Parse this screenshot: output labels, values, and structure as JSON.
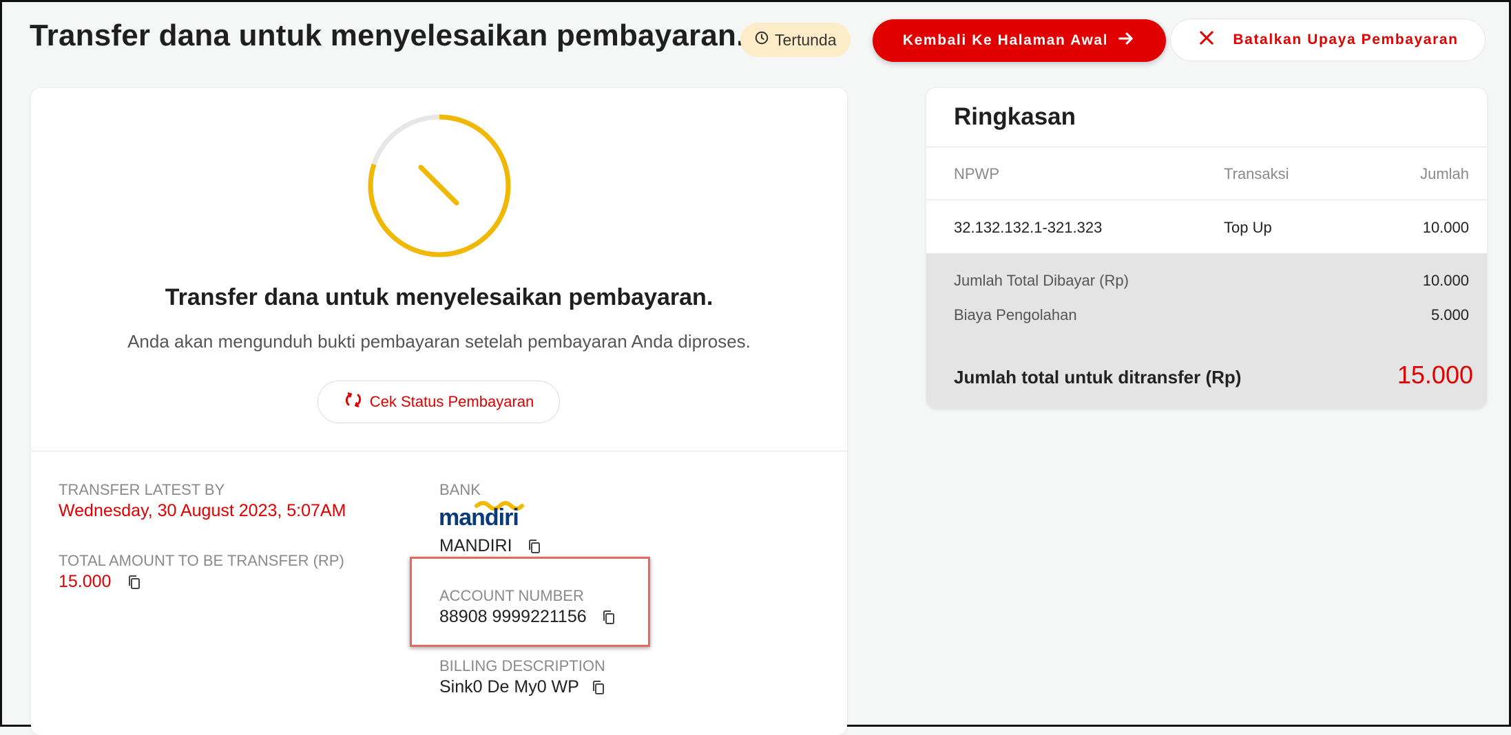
{
  "header": {
    "title": "Transfer dana untuk menyelesaikan pembayaran.",
    "status_badge": "Tertunda",
    "home_button": "Kembali Ke Halaman Awal",
    "cancel_button": "Batalkan Upaya Pembayaran"
  },
  "status_panel": {
    "title": "Transfer dana untuk menyelesaikan pembayaran.",
    "subtitle": "Anda akan mengunduh bukti pembayaran setelah pembayaran Anda diproses.",
    "check_button": "Cek Status Pembayaran",
    "progress_fraction": 0.8
  },
  "details": {
    "transfer_latest_label": "TRANSFER LATEST BY",
    "transfer_latest_value": "Wednesday, 30 August 2023, 5:07AM",
    "total_amount_label": "TOTAL AMOUNT TO BE TRANSFER (RP)",
    "total_amount_value": "15.000",
    "bank_label": "BANK",
    "bank_logo_text": "mandiri",
    "bank_value": "MANDIRI",
    "account_label": "ACCOUNT NUMBER",
    "account_value": "88908 9999221156",
    "billing_label": "BILLING DESCRIPTION",
    "billing_value": "Sink0 De My0 WP"
  },
  "summary": {
    "title": "Ringkasan",
    "columns": [
      "NPWP",
      "Transaksi",
      "Jumlah"
    ],
    "rows": [
      {
        "npwp": "32.132.132.1-321.323",
        "transaksi": "Top Up",
        "jumlah": "10.000"
      }
    ],
    "total_paid_label": "Jumlah Total Dibayar (Rp)",
    "total_paid_value": "10.000",
    "fee_label": "Biaya Pengolahan",
    "fee_value": "5.000",
    "grand_total_label": "Jumlah total untuk ditransfer (Rp)",
    "grand_total_value": "15.000"
  },
  "colors": {
    "accent": "#e00000",
    "pending_badge": "#fdecc8",
    "progress": "#f0b800"
  }
}
